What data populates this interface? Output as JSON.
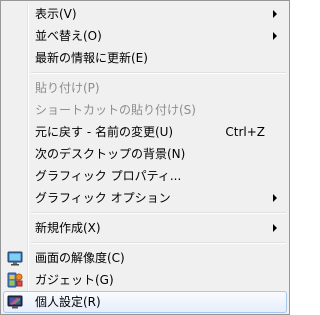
{
  "menu": {
    "view": "表示(V)",
    "sort": "並べ替え(O)",
    "refresh": "最新の情報に更新(E)",
    "paste": "貼り付け(P)",
    "paste_shortcut": "ショートカットの貼り付け(S)",
    "undo": "元に戻す - 名前の変更(U)",
    "undo_shortcut": "Ctrl+Z",
    "next_bg": "次のデスクトップの背景(N)",
    "graphics_props": "グラフィック プロパティ...",
    "graphics_options": "グラフィック オプション",
    "new": "新規作成(X)",
    "resolution": "画面の解像度(C)",
    "gadgets": "ガジェット(G)",
    "personalize": "個人設定(R)"
  },
  "icons": {
    "resolution": "monitor-icon",
    "gadgets": "gadget-icon",
    "personalize": "personalize-icon"
  }
}
